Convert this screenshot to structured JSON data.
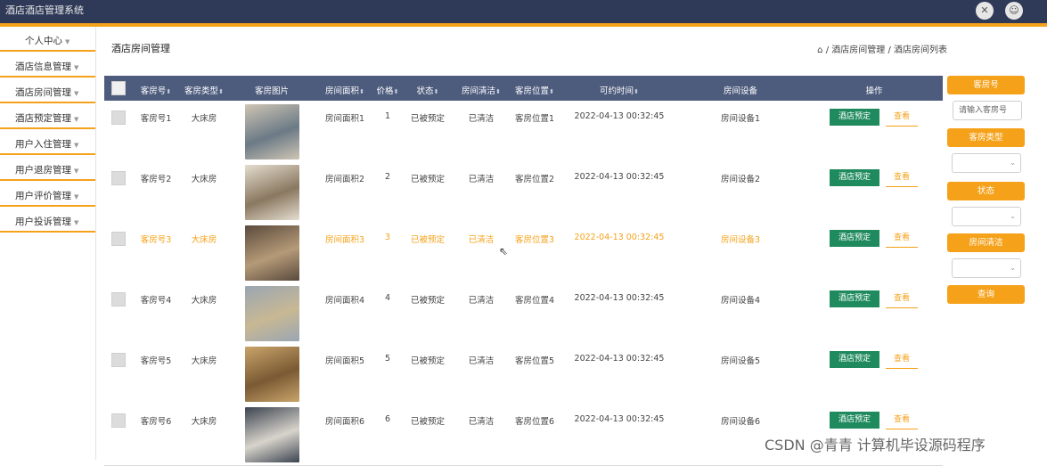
{
  "app": {
    "title": "酒店酒店管理系统"
  },
  "top_buttons": [
    "✕",
    "☺"
  ],
  "sidebar": {
    "items": [
      {
        "label": "个人中心"
      },
      {
        "label": "酒店信息管理"
      },
      {
        "label": "酒店房间管理"
      },
      {
        "label": "酒店预定管理"
      },
      {
        "label": "用户入住管理"
      },
      {
        "label": "用户退房管理"
      },
      {
        "label": "用户评价管理"
      },
      {
        "label": "用户投诉管理"
      }
    ]
  },
  "page": {
    "title": "酒店房间管理",
    "breadcrumb": "酒店房间管理 / 酒店房间列表"
  },
  "table": {
    "headers": [
      "客房号",
      "客房类型",
      "客房图片",
      "房间面积",
      "价格",
      "状态",
      "房间清洁",
      "客房位置",
      "可约时间",
      "房间设备",
      "操作"
    ],
    "book_label": "酒店预定",
    "view_label": "查看",
    "rows": [
      {
        "room": "客房号1",
        "type": "大床房",
        "area": "房间面积1",
        "price": "1",
        "status": "已被预定",
        "clean": "已清洁",
        "location": "客房位置1",
        "time": "2022-04-13 00:32:45",
        "equip": "房间设备1",
        "thumb": [
          "#cfc5b4",
          "#6b7a86"
        ]
      },
      {
        "room": "客房号2",
        "type": "大床房",
        "area": "房间面积2",
        "price": "2",
        "status": "已被预定",
        "clean": "已清洁",
        "location": "客房位置2",
        "time": "2022-04-13 00:32:45",
        "equip": "房间设备2",
        "thumb": [
          "#e4ddd0",
          "#8a7860"
        ]
      },
      {
        "room": "客房号3",
        "type": "大床房",
        "area": "房间面积3",
        "price": "3",
        "status": "已被预定",
        "clean": "已清洁",
        "location": "客房位置3",
        "time": "2022-04-13 00:32:45",
        "equip": "房间设备3",
        "thumb": [
          "#5a4a3c",
          "#b59a78"
        ]
      },
      {
        "room": "客房号4",
        "type": "大床房",
        "area": "房间面积4",
        "price": "4",
        "status": "已被预定",
        "clean": "已清洁",
        "location": "客房位置4",
        "time": "2022-04-13 00:32:45",
        "equip": "房间设备4",
        "thumb": [
          "#9aa6b2",
          "#c8b894"
        ]
      },
      {
        "room": "客房号5",
        "type": "大床房",
        "area": "房间面积5",
        "price": "5",
        "status": "已被预定",
        "clean": "已清洁",
        "location": "客房位置5",
        "time": "2022-04-13 00:32:45",
        "equip": "房间设备5",
        "thumb": [
          "#c9a46a",
          "#7a5a34"
        ]
      },
      {
        "room": "客房号6",
        "type": "大床房",
        "area": "房间面积6",
        "price": "6",
        "status": "已被预定",
        "clean": "已清洁",
        "location": "客房位置6",
        "time": "2022-04-13 00:32:45",
        "equip": "房间设备6",
        "thumb": [
          "#3c4450",
          "#d8d4cc"
        ]
      }
    ]
  },
  "filters": {
    "room_btn": "客房号",
    "room_placeholder": "请输入客房号",
    "type_btn": "客房类型",
    "status_btn": "状态",
    "clean_btn": "房间清洁",
    "query_btn": "查询"
  },
  "watermark": "CSDN @青青  计算机毕设源码程序",
  "colors": {
    "accent": "#f5a21a",
    "header": "#2f3a58",
    "table_head": "#4d5b7d",
    "book_button": "#1f8a5e"
  }
}
